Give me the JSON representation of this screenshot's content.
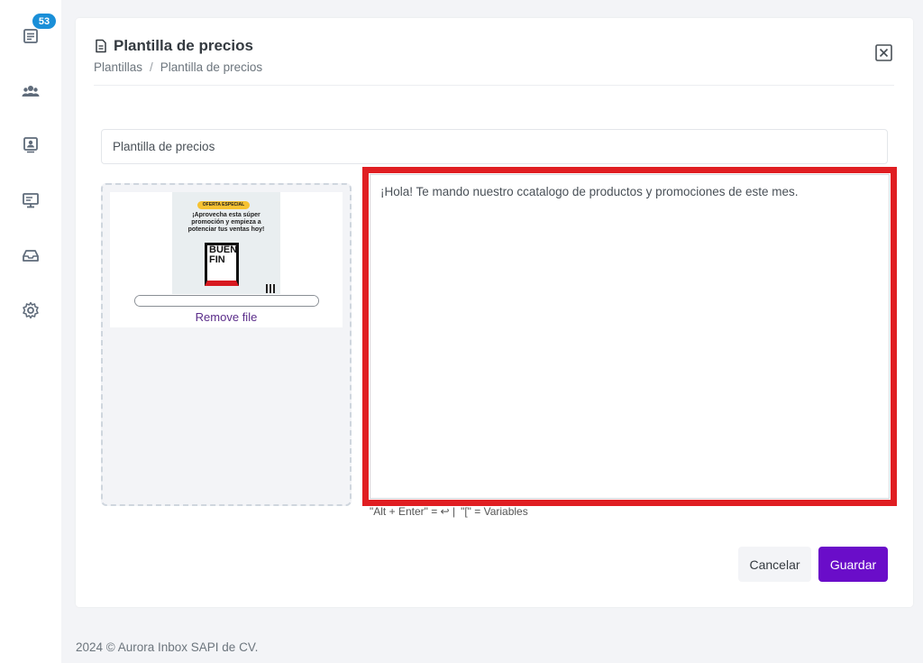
{
  "sidebar": {
    "items": [
      {
        "name": "inbox",
        "icon": "inbox-icon",
        "badge": "53"
      },
      {
        "name": "contacts",
        "icon": "users-icon"
      },
      {
        "name": "profiles",
        "icon": "contact-card-icon"
      },
      {
        "name": "monitor",
        "icon": "monitor-icon"
      },
      {
        "name": "inbox-tray",
        "icon": "inbox-tray-icon"
      },
      {
        "name": "settings",
        "icon": "gear-icon"
      }
    ]
  },
  "header": {
    "title": "Plantilla de precios",
    "breadcrumb": [
      "Plantillas",
      "Plantilla de precios"
    ],
    "breadcrumb_separator": "/"
  },
  "form": {
    "name_value": "Plantilla de precios",
    "file": {
      "remove_label": "Remove file",
      "preview": {
        "tag": "OFERTA ESPECIAL",
        "headline": "¡Aprovecha esta súper promoción y empieza a potenciar tus ventas hoy!",
        "box_text_1": "BUEN",
        "box_text_2": "FIN"
      }
    },
    "message_value": "¡Hola! Te mando nuestro ccatalogo de productos y promociones de este mes.",
    "hints": [
      "\"Alt + Enter\" = ↩ |",
      "\"[\" = Variables"
    ]
  },
  "actions": {
    "cancel_label": "Cancelar",
    "save_label": "Guardar"
  },
  "footer": {
    "text": "2024 © Aurora Inbox SAPI de CV."
  },
  "colors": {
    "accent": "#6a0dc9",
    "badge": "#1a8fd8",
    "highlight": "#e01e22"
  }
}
